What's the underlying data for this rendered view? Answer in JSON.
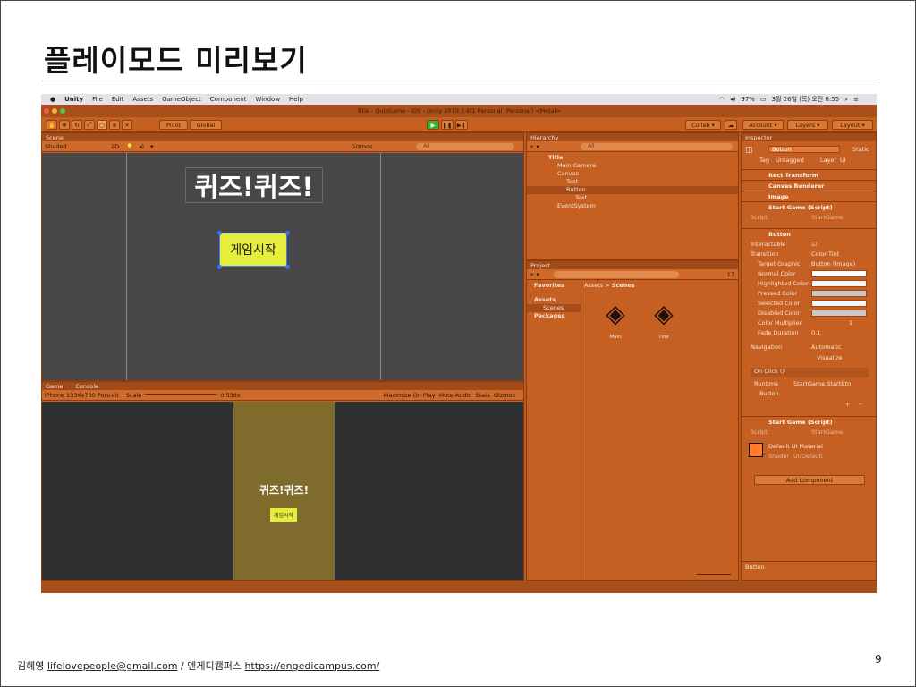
{
  "slide": {
    "title": "플레이모드 미리보기",
    "footer_author": "김혜영",
    "footer_email": "lifelovepeople@gmail.com",
    "footer_sep": "/",
    "footer_org": "엔게디캠퍼스",
    "footer_url": "https://engedicampus.com/",
    "page_number": "9"
  },
  "menubar": {
    "items": [
      "Unity",
      "File",
      "Edit",
      "Assets",
      "GameObject",
      "Component",
      "Window",
      "Help"
    ],
    "battery": "97%",
    "datetime": "3월 26일 (목) 오전 8:55"
  },
  "window": {
    "title": "Title - QuizGame - iOS - Unity 2019.3.6f1 Personal (Personal) <Metal>"
  },
  "toolbar": {
    "pivot": "Pivot",
    "global": "Global",
    "collab": "Collab ▾",
    "account": "Account",
    "layers": "Layers",
    "layout": "Layout"
  },
  "scene": {
    "tab": "Scene",
    "shading": "Shaded",
    "mode_2d": "2D",
    "gizmos": "Gizmos",
    "search_placeholder": "All",
    "quiz_title": "퀴즈!퀴즈!",
    "start_button": "게임시작"
  },
  "game": {
    "tab": "Game",
    "console_tab": "Console",
    "resolution": "iPhone 1334x750 Portrait",
    "scale_label": "Scale",
    "scale_value": "0.538x",
    "maximize": "Maximize On Play",
    "mute": "Mute Audio",
    "stats": "Stats",
    "gizmos": "Gizmos",
    "quiz_title": "퀴즈!퀴즈!",
    "start_button": "게임시작"
  },
  "hierarchy": {
    "tab": "Hierarchy",
    "search_placeholder": "All",
    "items": [
      {
        "label": "Title"
      },
      {
        "label": "Main Camera"
      },
      {
        "label": "Canvas"
      },
      {
        "label": "Text"
      },
      {
        "label": "Button"
      },
      {
        "label": "Text"
      },
      {
        "label": "EventSystem"
      }
    ]
  },
  "project": {
    "tab": "Project",
    "favorites": "Favorites",
    "assets": "Assets",
    "scenes": "Scenes",
    "packages": "Packages",
    "breadcrumb_assets": "Assets",
    "breadcrumb_sep": ">",
    "breadcrumb_scenes": "Scenes",
    "count": "17",
    "files": [
      {
        "name": "Main"
      },
      {
        "name": "Title"
      }
    ]
  },
  "inspector": {
    "tab": "Inspector",
    "object_name": "Button",
    "static_label": "Static",
    "tag_label": "Tag",
    "tag_value": "Untagged",
    "layer_label": "Layer",
    "layer_value": "UI",
    "components": {
      "rect_transform": "Rect Transform",
      "canvas_renderer": "Canvas Renderer",
      "image": "Image",
      "start_game_1": "Start Game (Script)",
      "button": "Button",
      "start_game_2": "Start Game (Script)"
    },
    "script_label": "Script",
    "script_value": "StartGame",
    "button_props": {
      "interactable": "Interactable",
      "transition": "Transition",
      "transition_value": "Color Tint",
      "target_graphic": "Target Graphic",
      "target_graphic_value": "Button (Image)",
      "normal": "Normal Color",
      "highlighted": "Highlighted Color",
      "pressed": "Pressed Color",
      "selected": "Selected Color",
      "disabled": "Disabled Color",
      "multiplier": "Color Multiplier",
      "multiplier_value": "1",
      "fade": "Fade Duration",
      "fade_value": "0.1",
      "navigation": "Navigation",
      "navigation_value": "Automatic",
      "visualize": "Visualize"
    },
    "onclick": {
      "header": "On Click ()",
      "runtime": "Runtime",
      "function": "StartGame.StartBtn",
      "object": "Button"
    },
    "material_name": "Default UI Material",
    "shader_label": "Shader",
    "shader_value": "UI/Default",
    "add_component": "Add Component",
    "footer_label": "Button"
  },
  "colors": {
    "playmode_tint": "#c55f22",
    "button_yellow": "#e5ef3b",
    "game_canvas": "#7f6b2c"
  }
}
